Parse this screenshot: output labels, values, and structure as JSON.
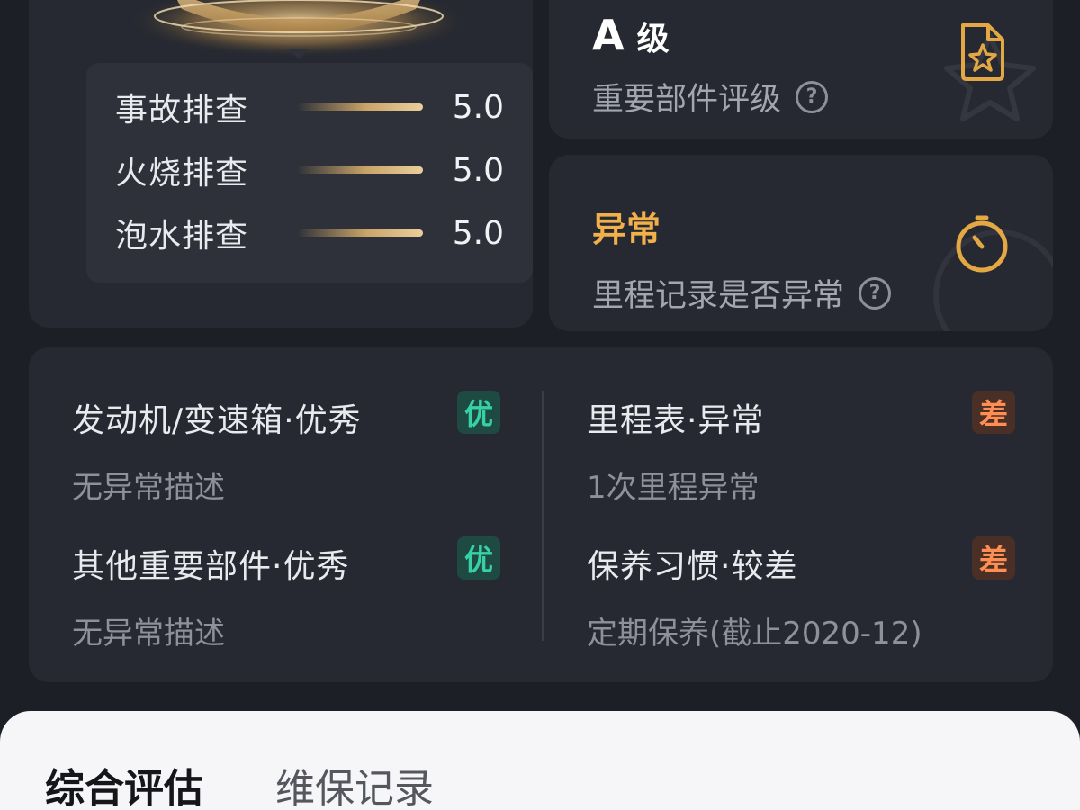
{
  "scores": [
    {
      "label": "事故排查",
      "value": "5.0"
    },
    {
      "label": "火烧排查",
      "value": "5.0"
    },
    {
      "label": "泡水排查",
      "value": "5.0"
    }
  ],
  "grade_card": {
    "grade": "A",
    "grade_suffix": "级",
    "subtitle": "重要部件评级",
    "help": "?"
  },
  "mileage_card": {
    "status": "异常",
    "subtitle": "里程记录是否异常",
    "help": "?"
  },
  "details": [
    {
      "title": "发动机/变速箱·优秀",
      "desc": "无异常描述",
      "badge": "优"
    },
    {
      "title": "里程表·异常",
      "desc": "1次里程异常",
      "badge": "差"
    },
    {
      "title": "其他重要部件·优秀",
      "desc": "无异常描述",
      "badge": "优"
    },
    {
      "title": "保养习惯·较差",
      "desc": "定期保养(截止2020-12)",
      "badge": "差"
    }
  ],
  "tabs": [
    {
      "label": "综合评估",
      "active": true
    },
    {
      "label": "维保记录",
      "active": false
    }
  ],
  "colors": {
    "background": "#1d1f26",
    "card": "#262931",
    "accent_gold": "#f1b04a",
    "good": "#36d1a6",
    "bad": "#ff8e52"
  },
  "icons": {
    "grade": "star-document-icon",
    "mileage": "stopwatch-icon",
    "help": "help-circle-icon"
  }
}
